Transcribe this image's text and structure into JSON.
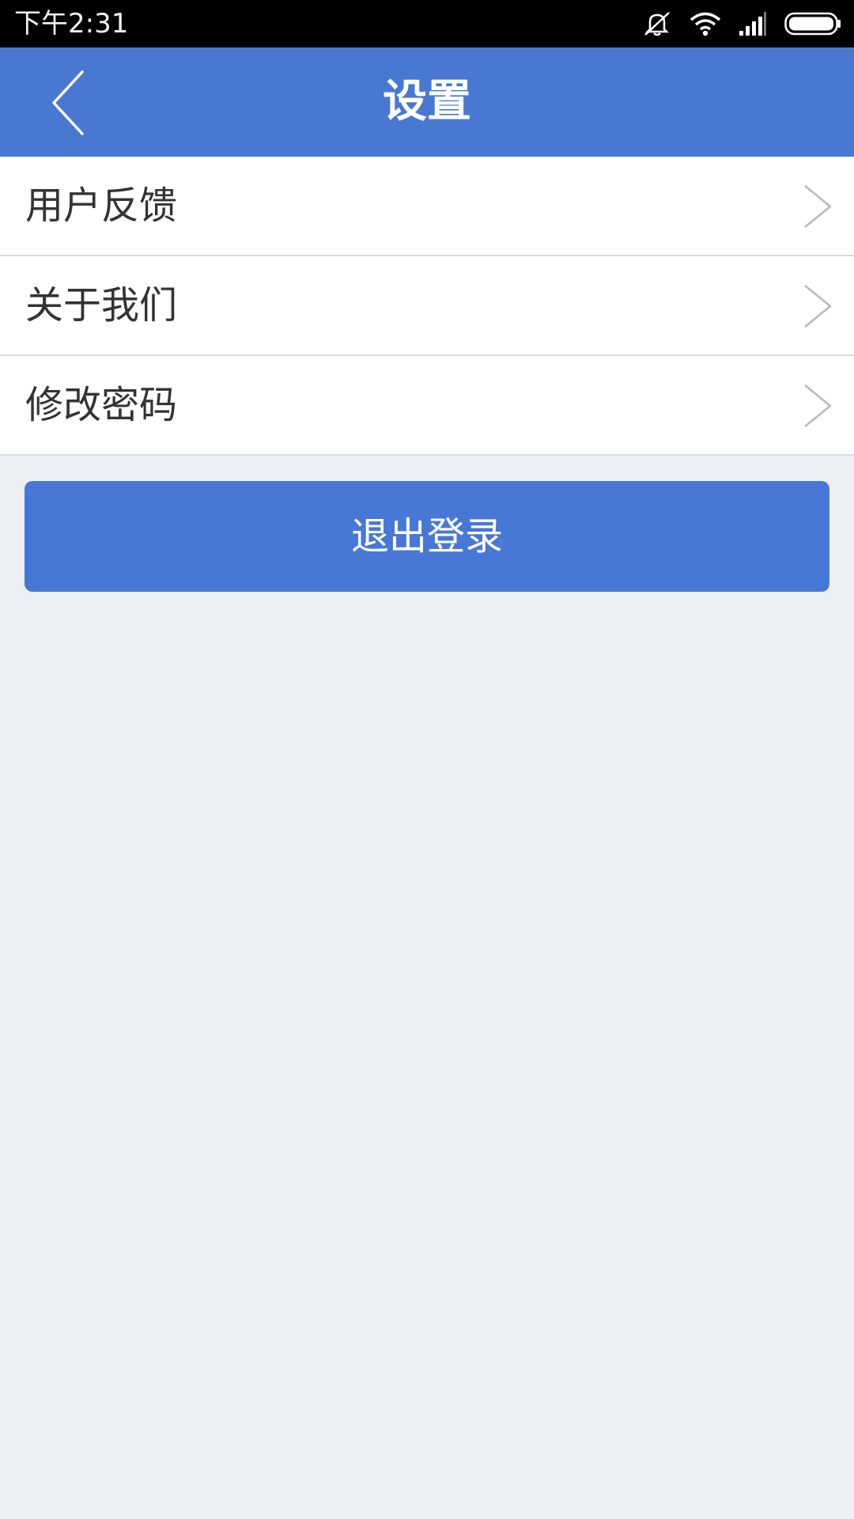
{
  "status_bar": {
    "time": "下午2:31",
    "icons": [
      "mute-icon",
      "wifi-icon",
      "signal-icon",
      "battery-icon"
    ]
  },
  "header": {
    "title": "设置",
    "back_icon": "back-arrow-icon",
    "background": "#4878d2"
  },
  "menu": {
    "items": [
      {
        "label": "用户反馈",
        "icon": "chevron-right-icon"
      },
      {
        "label": "关于我们",
        "icon": "chevron-right-icon"
      },
      {
        "label": "修改密码",
        "icon": "chevron-right-icon"
      }
    ]
  },
  "logout": {
    "label": "退出登录",
    "color": "#4878d6"
  },
  "colors": {
    "page_background": "#ecf0f4",
    "text": "#333333",
    "divider": "#dcdcdc"
  }
}
